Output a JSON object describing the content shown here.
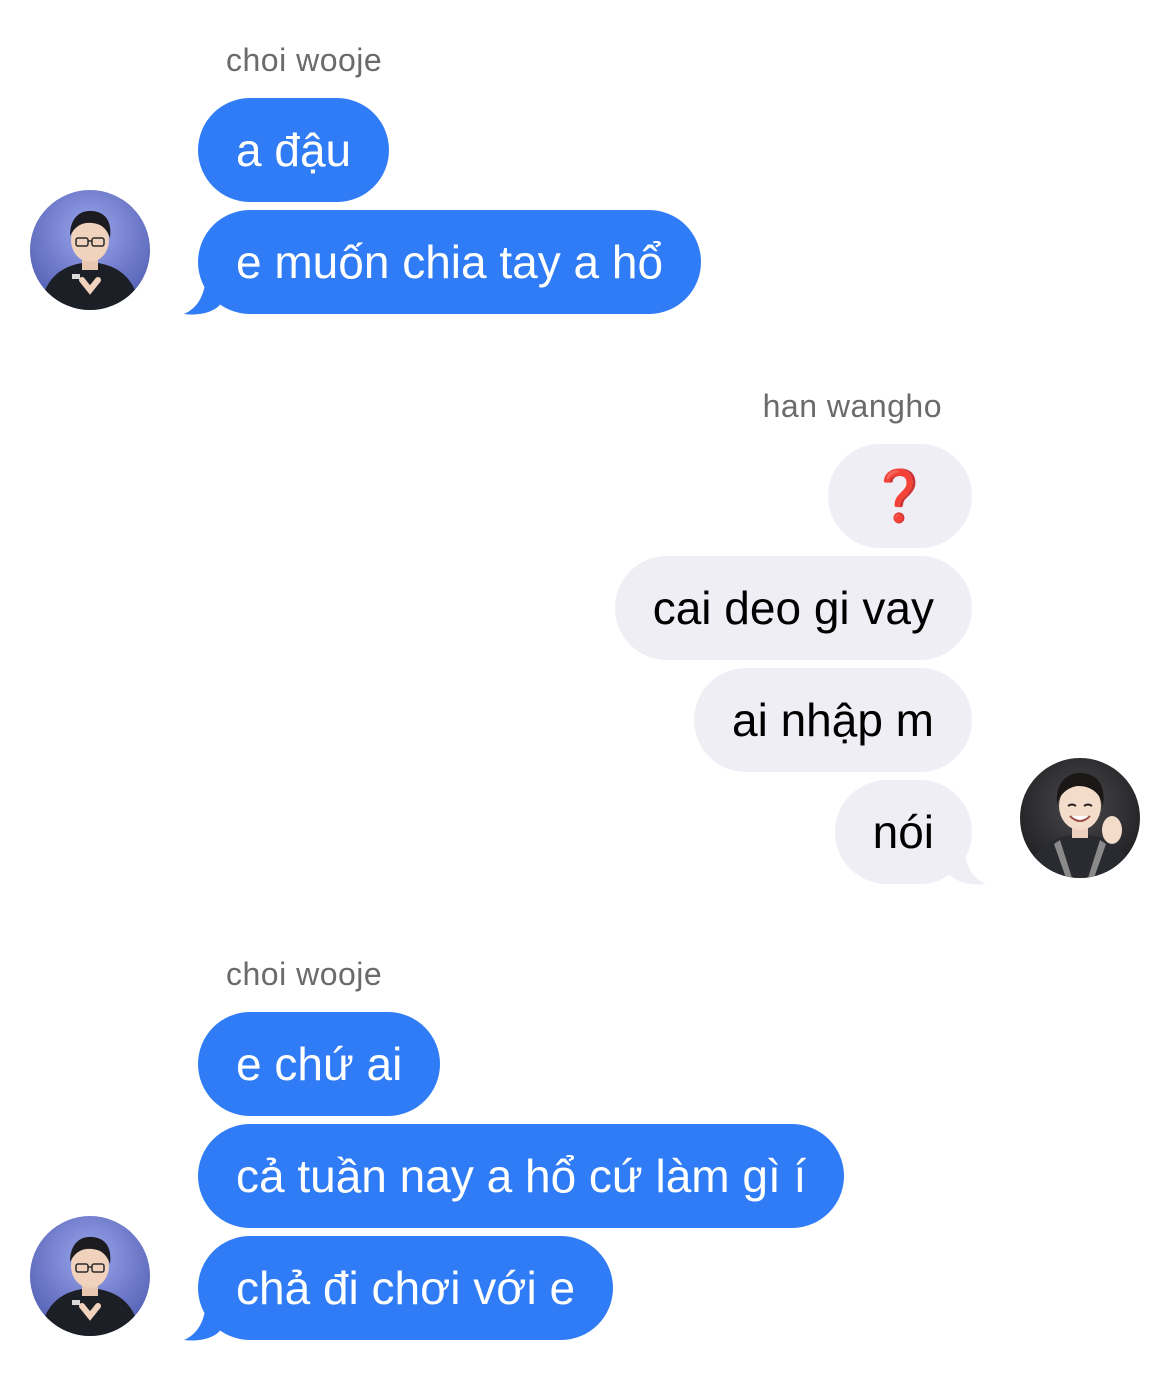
{
  "conversation": {
    "groups": [
      {
        "sender": "choi wooje",
        "side": "incoming",
        "messages": [
          "a đậu",
          "e muốn chia tay a hổ"
        ]
      },
      {
        "sender": "han wangho",
        "side": "outgoing",
        "messages": [
          "❓",
          "cai deo gi vay",
          "ai nhập m",
          "nói"
        ]
      },
      {
        "sender": "choi wooje",
        "side": "incoming",
        "messages": [
          "e chứ ai",
          "cả tuần nay a hổ cứ làm gì í",
          "chả đi chơi với e"
        ]
      }
    ]
  },
  "colors": {
    "incoming_bubble": "#2f7cf6",
    "outgoing_bubble": "#efeef5",
    "sender_name": "#6b6b6b",
    "question_mark": "#d8282b"
  },
  "icons": {
    "incoming_avatar": "avatar-photo-choi-wooje",
    "outgoing_avatar": "avatar-photo-han-wangho"
  }
}
